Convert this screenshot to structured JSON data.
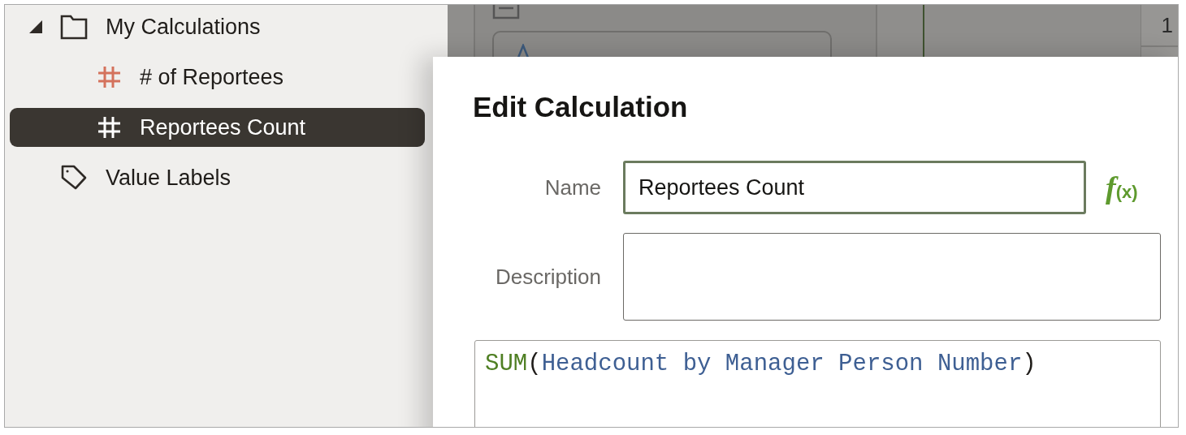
{
  "sidebar": {
    "tree": [
      {
        "label": "My Calculations",
        "kind": "folder",
        "expanded": true,
        "selected": false,
        "children": [
          {
            "label": "# of Reportees",
            "kind": "measure",
            "selected": false
          },
          {
            "label": "Reportees Count",
            "kind": "measure",
            "selected": true
          }
        ]
      },
      {
        "label": "Value Labels",
        "kind": "labels",
        "selected": false
      }
    ]
  },
  "backdrop": {
    "cell": "1"
  },
  "dialog": {
    "title": "Edit Calculation",
    "fields": [
      {
        "label": "Name",
        "kind": "text",
        "value": "Reportees Count",
        "focused": true,
        "function_button": "*f*(x)"
      },
      {
        "label": "Description",
        "kind": "textarea",
        "focused": false
      }
    ],
    "formula": [
      {
        "text": "SUM",
        "kind": "function"
      },
      {
        "text": "(",
        "kind": "punct"
      },
      {
        "text": "Headcount by Manager Person Number",
        "kind": "column"
      },
      {
        "text": ")",
        "kind": "punct"
      }
    ]
  }
}
